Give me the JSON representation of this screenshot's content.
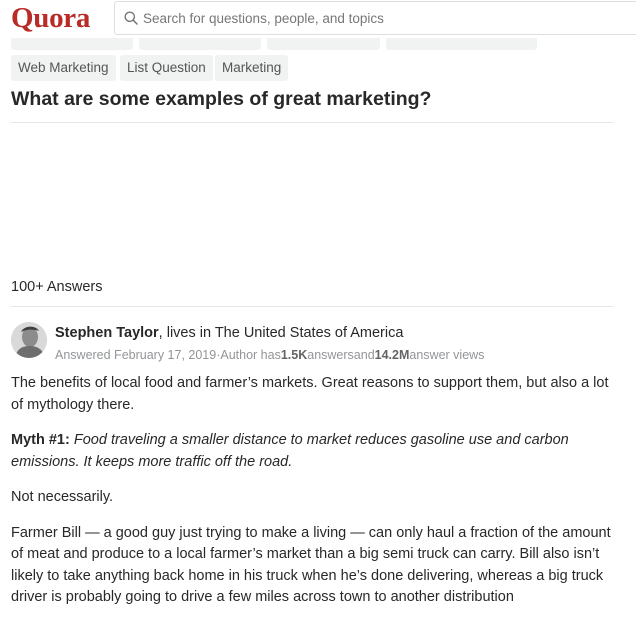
{
  "header": {
    "logo": "Quora",
    "search_placeholder": "Search for questions, people, and topics"
  },
  "topics_visible": [
    "Web Marketing",
    "List Question",
    "Marketing"
  ],
  "question": "What are some examples of great marketing?",
  "answers_count": "100+ Answers",
  "answer": {
    "author_name": "Stephen Taylor",
    "author_credential": ", lives in The United States of America",
    "answered_date": "Answered February 17, 2019",
    "author_stats_prefix": "·Author has",
    "answers_total": "1.5K",
    "answers_word": "answersand",
    "views_total": "14.2M",
    "views_word": "answer views",
    "paragraph_1": "The benefits of local food and farmer’s markets. Great reasons to support them, but also a lot of mythology there.",
    "myth_label": "Myth #1:",
    "myth_text": "Food traveling a smaller distance to market reduces gasoline use and carbon emissions. It keeps more traffic off the road.",
    "paragraph_3": "Not necessarily.",
    "paragraph_4": "Farmer Bill — a good guy just trying to make a living — can only haul a fraction of the amount of meat and produce to a local farmer’s market than a big semi truck can carry. Bill also isn’t likely to take anything back home in his truck when he’s done delivering, whereas a big truck driver is probably going to drive a few miles across town to another distribution"
  },
  "colors": {
    "brand": "#b92b27",
    "chip_bg": "#f1f2f2",
    "meta_text": "#939598"
  }
}
